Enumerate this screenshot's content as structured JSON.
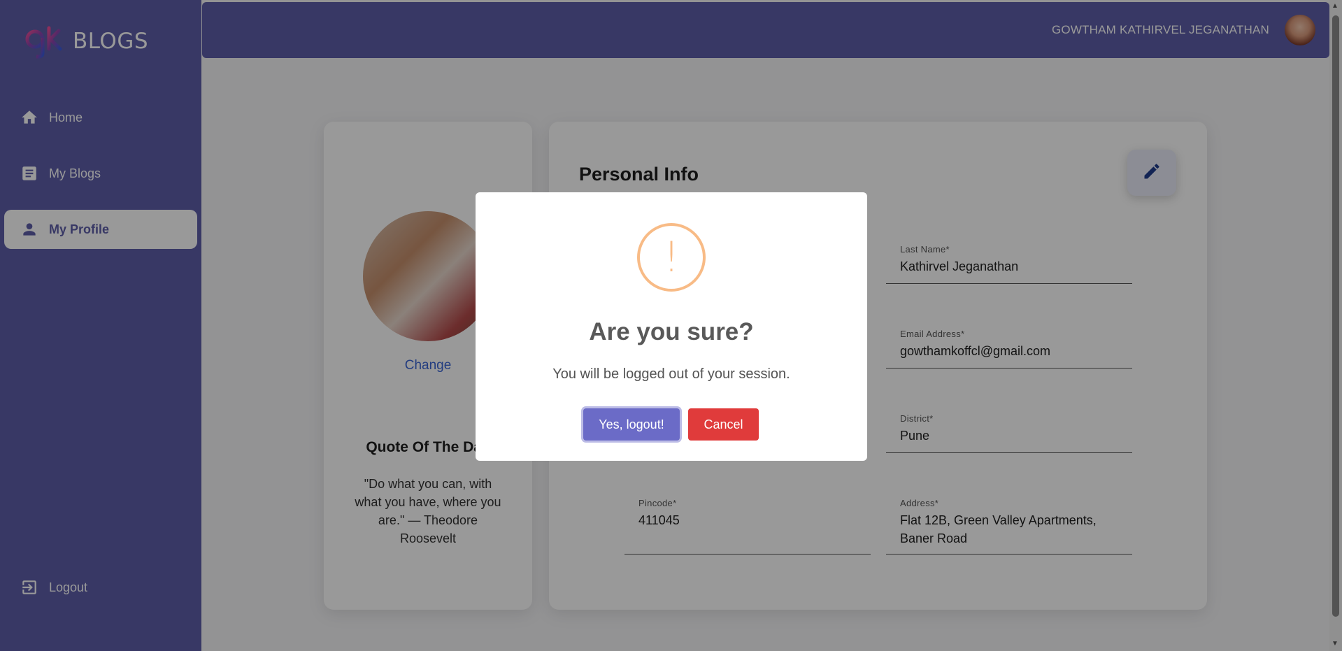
{
  "app": {
    "logo_text": "BLOGS"
  },
  "sidebar": {
    "items": [
      {
        "label": "Home",
        "icon": "home-icon"
      },
      {
        "label": "My Blogs",
        "icon": "article-icon"
      },
      {
        "label": "My Profile",
        "icon": "person-icon",
        "active": true
      }
    ],
    "logout_label": "Logout"
  },
  "topbar": {
    "user_name": "GOWTHAM KATHIRVEL JEGANATHAN"
  },
  "profile": {
    "change_label": "Change",
    "quote_title": "Quote Of The Day",
    "quote_text": "\"Do what you can, with what you have, where you are.\" — Theodore Roosevelt"
  },
  "personal_info": {
    "title": "Personal Info",
    "fields": {
      "last_name": {
        "label": "Last Name*",
        "value": "Kathirvel Jeganathan"
      },
      "email": {
        "label": "Email Address*",
        "value": "gowthamkoffcl@gmail.com"
      },
      "district": {
        "label": "District*",
        "value": "Pune"
      },
      "pincode": {
        "label": "Pincode*",
        "value": "411045"
      },
      "address": {
        "label": "Address*",
        "value": "Flat 12B, Green Valley Apartments, Baner Road"
      }
    }
  },
  "dialog": {
    "title": "Are you sure?",
    "text": "You will be logged out of your session.",
    "confirm_label": "Yes, logout!",
    "cancel_label": "Cancel"
  },
  "colors": {
    "primary": "#5e5ea8",
    "warning": "#f8bb86",
    "danger": "#e03b3b",
    "confirm": "#6b6bc7"
  }
}
